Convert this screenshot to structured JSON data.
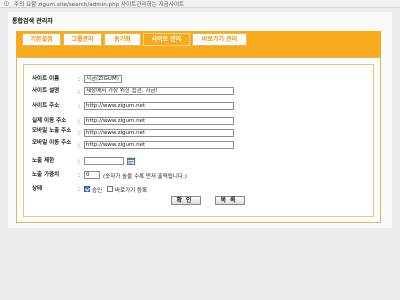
{
  "browser": {
    "address_text": "주의 요함   zigum.site/search/admin.php   사이트관리하는 지금사이트"
  },
  "page": {
    "heading": "통합검색 관리자"
  },
  "tabs": [
    {
      "label": "기본설정",
      "active": false
    },
    {
      "label": "그룹관리",
      "active": false
    },
    {
      "label": "동기화",
      "active": false
    },
    {
      "label": "사이트 관리",
      "active": true
    },
    {
      "label": "바로가기 관리",
      "active": false
    }
  ],
  "form": {
    "site_name": {
      "label": "사이트 이름",
      "value": "지금(ZIGUM)"
    },
    "site_desc": {
      "label": "사이트 설명",
      "value": "세상에서 가장 위한 습관, 지금!"
    },
    "site_url": {
      "label": "사이트 주소",
      "value": "http://www.zigum.net"
    },
    "real_url": {
      "label": "실제 이동 주소",
      "value": "http://www.zigum.net"
    },
    "mobile_url": {
      "label": "모바일 노출 주소",
      "value": "http://www.zigum.net"
    },
    "mobile_move_url": {
      "label": "모바일 이동 주소",
      "value": "http://www.zigum.net"
    },
    "expose_limit": {
      "label": "노출 제한",
      "value": ""
    },
    "expose_weight": {
      "label": "노출 가중치",
      "value": "0",
      "hint": "(숫자가 높을 수록 먼저 출력됩니다.)"
    },
    "status": {
      "label": "상태",
      "approve_label": "승인",
      "approve_checked": true,
      "shortcut_label": "바로가기 등록",
      "shortcut_checked": false
    },
    "confirm_label": "확인",
    "back_label": "목록"
  },
  "colors": {
    "accent": "#f7aa1c",
    "tab_text": "#f08f0f",
    "check": "#3d7fe0"
  }
}
